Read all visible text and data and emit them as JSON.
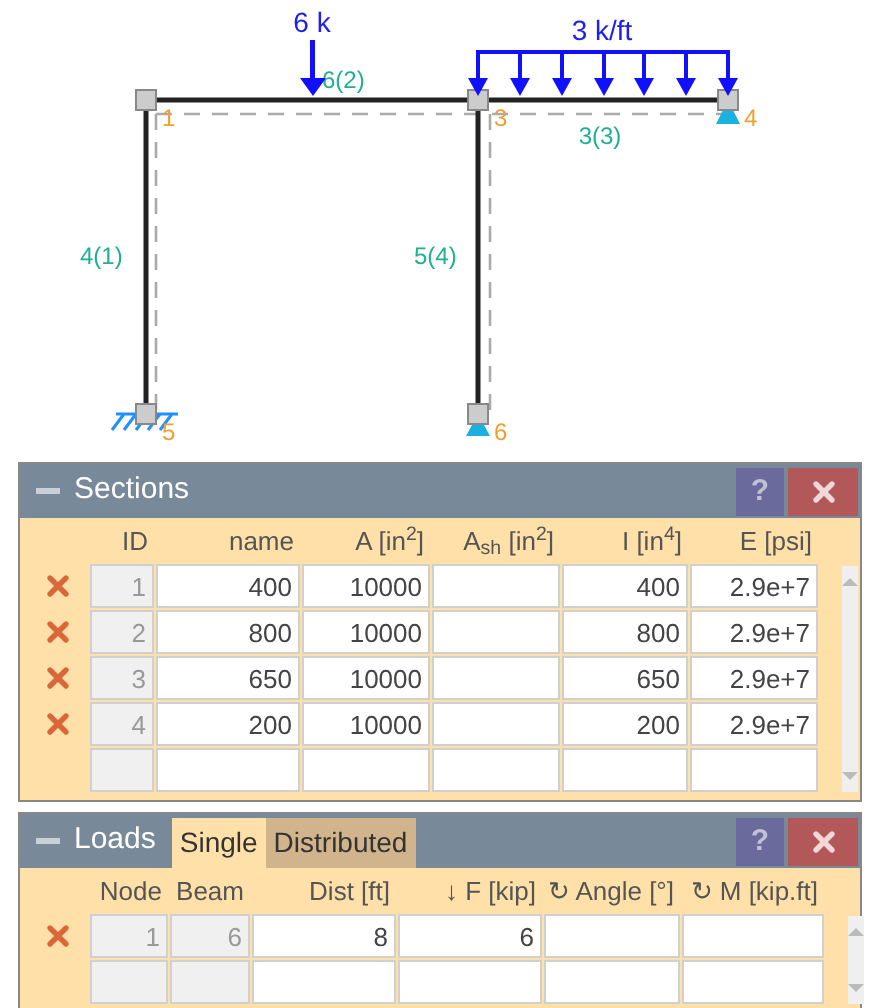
{
  "diagram": {
    "nodes": [
      "1",
      "3",
      "4",
      "5",
      "6"
    ],
    "beams": [
      "6(2)",
      "3(3)",
      "4(1)",
      "5(4)"
    ],
    "loads": [
      {
        "kind": "point",
        "label": "6 k"
      },
      {
        "kind": "distributed",
        "label": "3 k/ft"
      }
    ]
  },
  "sections": {
    "title": "Sections",
    "help": "?",
    "columns": [
      {
        "label": "ID",
        "readonly": true
      },
      {
        "label": "name",
        "readonly": false
      },
      {
        "label": "A [in$^{2}$]",
        "readonly": false
      },
      {
        "label": "A$_{sh}$ [in$^{2}$]",
        "readonly": false
      },
      {
        "label": "I [in$^{4}$]",
        "readonly": false
      },
      {
        "label": "E [psi]",
        "readonly": false
      }
    ],
    "rows": [
      [
        "1",
        "400",
        "10000",
        "",
        "400",
        "2.9e+7"
      ],
      [
        "2",
        "800",
        "10000",
        "",
        "800",
        "2.9e+7"
      ],
      [
        "3",
        "650",
        "10000",
        "",
        "650",
        "2.9e+7"
      ],
      [
        "4",
        "200",
        "10000",
        "",
        "200",
        "2.9e+7"
      ]
    ]
  },
  "loads": {
    "title": "Loads",
    "help": "?",
    "tabs": [
      {
        "label": "Single",
        "selected": true
      },
      {
        "label": "Distributed",
        "selected": false
      }
    ],
    "columns": [
      {
        "label": "Node",
        "readonly": true
      },
      {
        "label": "Beam",
        "readonly": true
      },
      {
        "label": "Dist [ft]",
        "readonly": false
      },
      {
        "label": "↓ F [kip]",
        "readonly": false
      },
      {
        "label": "↻ Angle [°]",
        "readonly": false
      },
      {
        "label": "↻ M [kip.ft]",
        "readonly": false
      }
    ],
    "rows": [
      [
        "1",
        "6",
        "8",
        "6",
        "",
        ""
      ]
    ]
  }
}
